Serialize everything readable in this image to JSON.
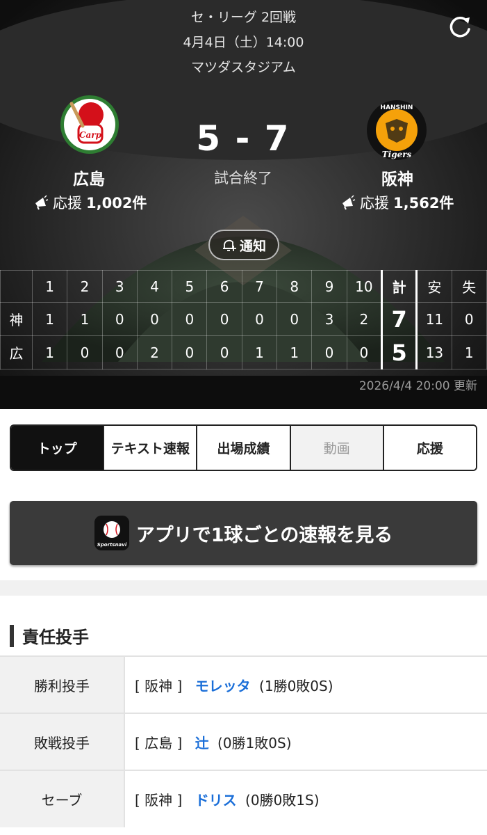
{
  "game": {
    "league": "セ・リーグ 2回戦",
    "datetime": "4月4日（土）14:00",
    "venue": "マツダスタジアム",
    "score": "5 - 7",
    "status": "試合終了",
    "notify_label": "通知",
    "updated": "2026/4/4 20:00 更新"
  },
  "home": {
    "name": "広島",
    "cheer_label": "応援",
    "cheer_count": "1,002件",
    "logo_text": "Carp"
  },
  "away": {
    "name": "阪神",
    "cheer_label": "応援",
    "cheer_count": "1,562件",
    "logo_text_top": "HANSHIN",
    "logo_text_bottom": "Tigers"
  },
  "scoreboard": {
    "headers": [
      "",
      "1",
      "2",
      "3",
      "4",
      "5",
      "6",
      "7",
      "8",
      "9",
      "10",
      "計",
      "安",
      "失"
    ],
    "rows": [
      [
        "神",
        "1",
        "1",
        "0",
        "0",
        "0",
        "0",
        "0",
        "0",
        "3",
        "2",
        "7",
        "11",
        "0"
      ],
      [
        "広",
        "1",
        "0",
        "0",
        "2",
        "0",
        "0",
        "1",
        "1",
        "0",
        "0",
        "5",
        "13",
        "1"
      ]
    ]
  },
  "tabs": [
    {
      "label": "トップ",
      "state": "active"
    },
    {
      "label": "テキスト速報",
      "state": "normal"
    },
    {
      "label": "出場成績",
      "state": "normal"
    },
    {
      "label": "動画",
      "state": "disabled"
    },
    {
      "label": "応援",
      "state": "normal"
    }
  ],
  "app_banner": {
    "label": "アプリで1球ごとの速報を見る",
    "icon_text": "Sportsnavi"
  },
  "pitchers": {
    "title": "責任投手",
    "rows": [
      {
        "role": "勝利投手",
        "team": "[ 阪神 ]",
        "name": "モレッタ",
        "record": "(1勝0敗0S)"
      },
      {
        "role": "敗戦投手",
        "team": "[ 広島 ]",
        "name": "辻",
        "record": "(0勝1敗0S)"
      },
      {
        "role": "セーブ",
        "team": "[ 阪神 ]",
        "name": "ドリス",
        "record": "(0勝0敗1S)"
      }
    ]
  },
  "colors": {
    "accent_link": "#1a6ed8",
    "carp_red": "#d4101a",
    "tigers_orange": "#f5a10a",
    "hero_bg": "#1a1a1a"
  }
}
